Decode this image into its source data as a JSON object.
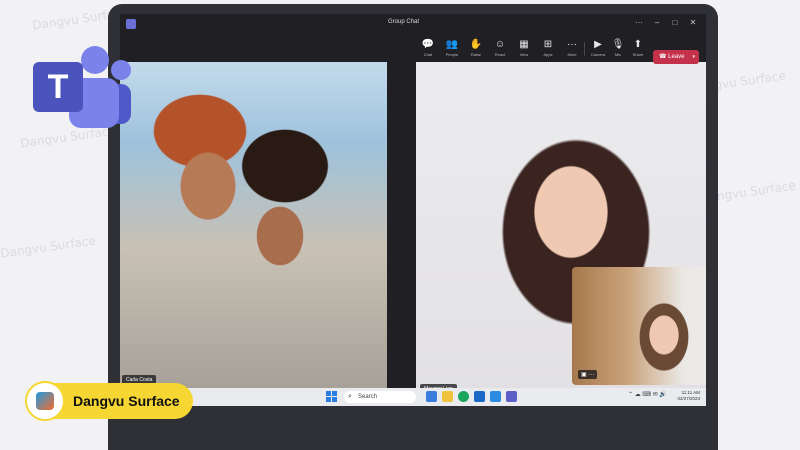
{
  "window": {
    "title": "Group Chat"
  },
  "window_controls": {
    "more": "···",
    "minimize": "–",
    "maximize": "□",
    "close": "✕"
  },
  "toolbar": {
    "items": [
      {
        "label": "Chat",
        "icon": "chat-icon",
        "glyph": "💬"
      },
      {
        "label": "People",
        "icon": "people-icon",
        "glyph": "👥"
      },
      {
        "label": "Raise",
        "icon": "raise-hand-icon",
        "glyph": "✋"
      },
      {
        "label": "React",
        "icon": "react-icon",
        "glyph": "☺"
      },
      {
        "label": "View",
        "icon": "view-icon",
        "glyph": "▦"
      },
      {
        "label": "Apps",
        "icon": "apps-icon",
        "glyph": "⊞"
      },
      {
        "label": "More",
        "icon": "more-icon",
        "glyph": "···"
      },
      {
        "label": "Camera",
        "icon": "camera-icon",
        "glyph": "▶"
      },
      {
        "label": "Mic",
        "icon": "mic-icon",
        "glyph": "🎙"
      },
      {
        "label": "Share",
        "icon": "share-icon",
        "glyph": "⬆"
      }
    ],
    "leave": {
      "label": "Leave",
      "icon": "phone-hangup-icon",
      "glyph": "☎"
    }
  },
  "participants": [
    {
      "name": "Carla Costa"
    },
    {
      "name": "Mayang Lien"
    }
  ],
  "pip": {
    "controls": "▣ ···"
  },
  "taskbar": {
    "search_label": "Search",
    "clock_time": "11:11 AM",
    "clock_date": "02/27/2023"
  },
  "brand": {
    "name": "Dangvu Surface",
    "logo_letter": "T"
  },
  "watermark": "Dangvu Surface",
  "colors": {
    "leave": "#c4314b",
    "teams": "#5b5fc7",
    "brand": "#f5d632"
  }
}
